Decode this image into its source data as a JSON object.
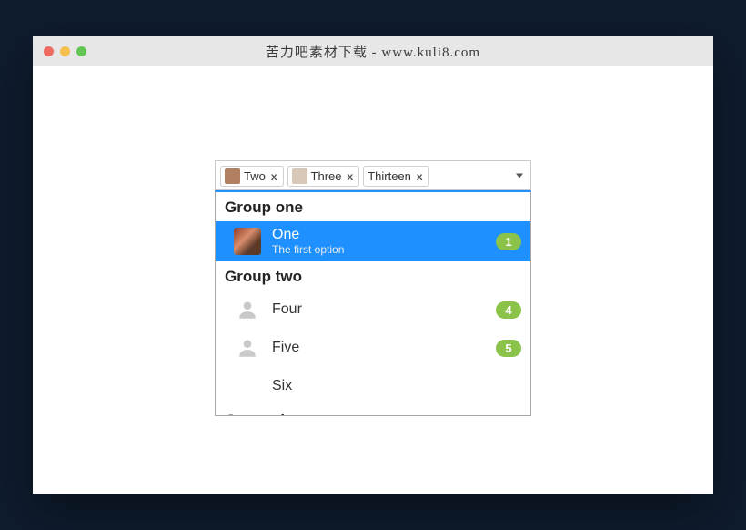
{
  "window": {
    "title": "苦力吧素材下载 - www.kuli8.com"
  },
  "selected_tags": [
    {
      "label": "Two",
      "avatar": 1
    },
    {
      "label": "Three",
      "avatar": 2
    },
    {
      "label": "Thirteen",
      "avatar": 0
    }
  ],
  "tag_close": "x",
  "groups": [
    {
      "label": "Group one",
      "options": [
        {
          "title": "One",
          "subtitle": "The first option",
          "badge": "1",
          "highlight": true,
          "avatar": "photo"
        }
      ]
    },
    {
      "label": "Group two",
      "options": [
        {
          "title": "Four",
          "badge": "4",
          "avatar": "icon"
        },
        {
          "title": "Five",
          "badge": "5",
          "avatar": "icon"
        },
        {
          "title": "Six",
          "avatar": "none"
        }
      ]
    },
    {
      "label": "Group three",
      "options": []
    }
  ]
}
